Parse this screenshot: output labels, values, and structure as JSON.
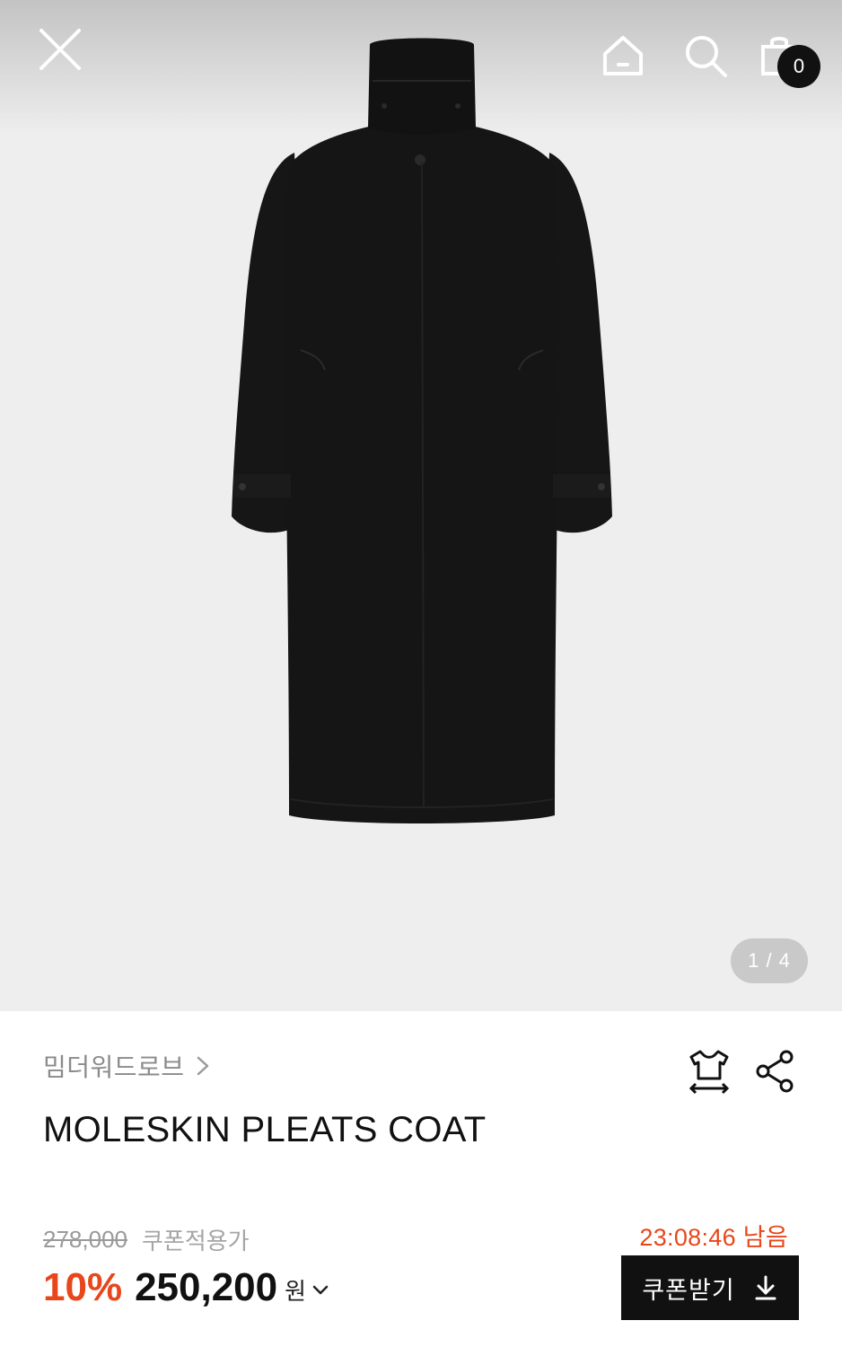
{
  "header": {
    "icons": [
      "close-icon",
      "home-icon",
      "search-icon",
      "shopping-bag-icon"
    ],
    "cart_count": "0"
  },
  "gallery": {
    "current": 1,
    "total": 4,
    "counter_label": "1 / 4",
    "background_color": "#eeeeee",
    "product_color": "#141414"
  },
  "product": {
    "brand": "밈더워드로브",
    "title": "MOLESKIN PLEATS COAT"
  },
  "actions": {
    "icons": [
      "size-guide-icon",
      "share-icon"
    ]
  },
  "pricing": {
    "original_price": "278,000",
    "coupon_label": "쿠폰적용가",
    "discount_rate": "10%",
    "sale_price": "250,200",
    "currency_unit": "원",
    "timer": "23:08:46 남음",
    "coupon_button_label": "쿠폰받기",
    "accent_color": "#e7471a"
  }
}
